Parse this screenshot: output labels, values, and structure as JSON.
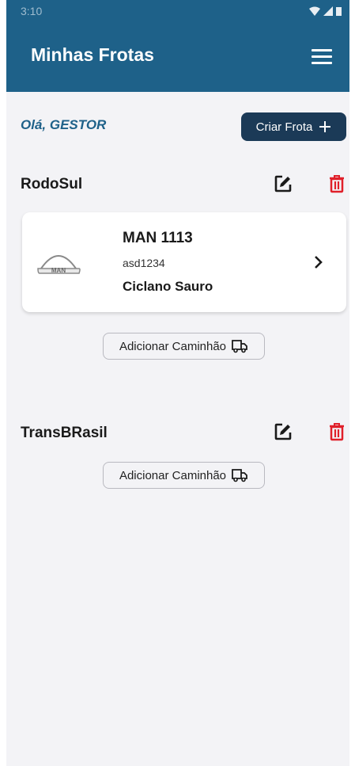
{
  "status": {
    "time": "3:10"
  },
  "header": {
    "title": "Minhas Frotas",
    "menu_icon": "menu-icon"
  },
  "greeting": "Olá, GESTOR",
  "create_button": {
    "label": "Criar Frota",
    "icon": "plus-icon"
  },
  "fleets": [
    {
      "name": "RodoSul",
      "trucks": [
        {
          "model": "MAN 1113",
          "plate": "asd1234",
          "driver": "Ciclano Sauro",
          "brand_logo": "MAN"
        }
      ],
      "add_label": "Adicionar Caminhão"
    },
    {
      "name": "TransBRasil",
      "trucks": [],
      "add_label": "Adicionar Caminhão"
    }
  ],
  "colors": {
    "primary": "#1e6189",
    "button_dark": "#1b3a57",
    "delete": "#e0202a",
    "background": "#f3f3f6"
  }
}
